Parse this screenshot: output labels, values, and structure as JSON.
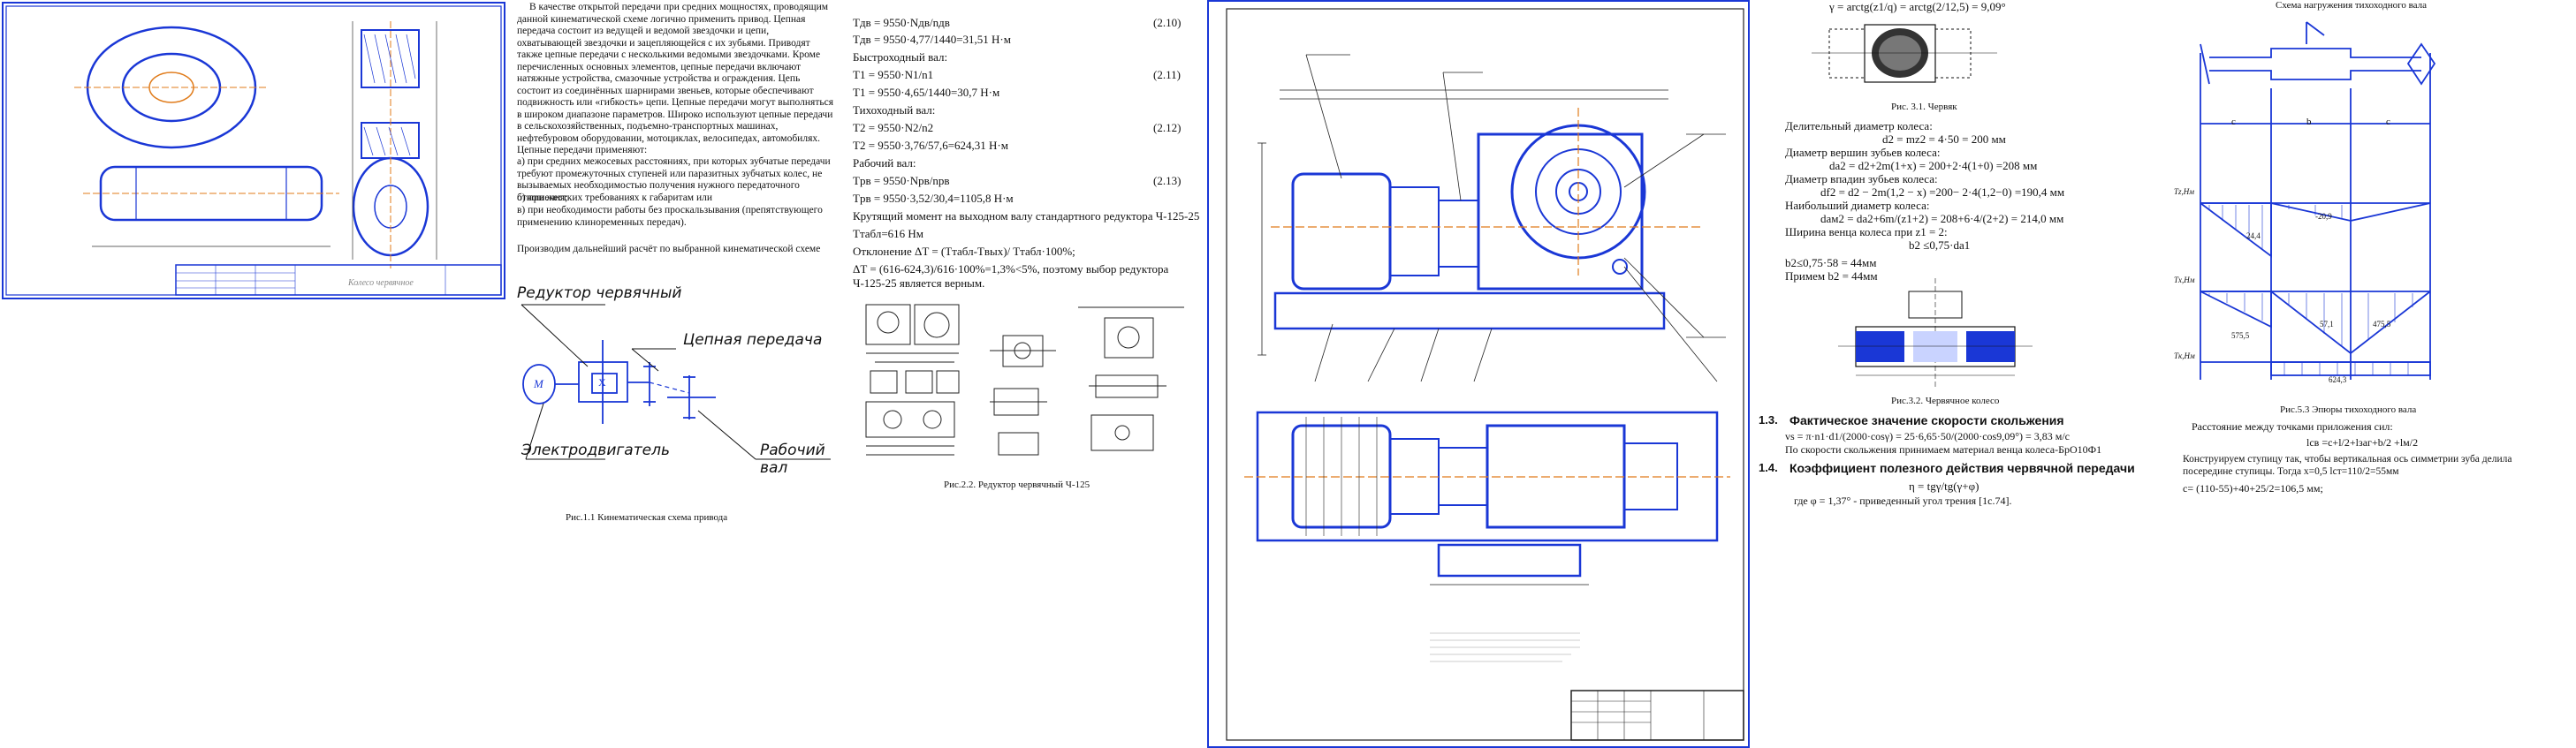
{
  "panel1": {
    "stamp": "Колесо червячное"
  },
  "panel2": {
    "paragraphs": [
      "В качестве открытой передачи при средних мощностях, проводящим данной кинематической схеме логично применить привод. Цепная передача состоит из ведущей и ведомой звездочки и цепи, охватывающей звездочки и зацепляющейся с их зубьями. Приводят также цепные передачи с несколькими ведомыми звездочками. Кроме перечисленных основных элементов, цепные передачи включают натяжные устройства, смазочные устройства и ограждения. Цепь состоит из соединённых шарнирами звеньев, которые обеспечивают подвижность или «гибкость» цепи. Цепные передачи могут выполняться в широком диапазоне параметров. Широко используют цепные передачи в сельскохозяйственных, подъемно-транспортных машинах, нефтебуровом оборудовании, мотоциклах, велосипедах, автомобилях. Цепные передачи применяют:",
      "а) при средних межосевых расстояниях, при которых зубчатые передачи требуют промежуточных ступеней или паразитных зубчатых колес, не вызываемых необходимостью получения нужного передаточного отношения;",
      "б) при жестких требованиях к габаритам или",
      "в) при необходимости работы без проскальзывания (препятствующего применению клиноременных передач).",
      "Производим дальнейший расчёт по выбранной кинематической схеме"
    ],
    "labels": {
      "reducer": "Редуктор червячный",
      "chain": "Цепная передача",
      "motor": "Электродвигатель",
      "shaft": "Рабочий вал",
      "m": "М",
      "x": "X"
    },
    "caption": "Рис.1.1 Кинематическая схема привода"
  },
  "panel3": {
    "lines": [
      {
        "text": "Tдв = 9550·Nдв/nдв",
        "num": "(2.10)"
      },
      {
        "text": "Tдв = 9550·4,77/1440=31,51 Н·м",
        "num": ""
      },
      {
        "text": "Быстроходный вал:",
        "num": ""
      },
      {
        "text": "T1 = 9550·N1/n1",
        "num": "(2.11)"
      },
      {
        "text": "T1 = 9550·4,65/1440=30,7 Н·м",
        "num": ""
      },
      {
        "text": "Тихоходный вал:",
        "num": ""
      },
      {
        "text": "T2 = 9550·N2/n2",
        "num": "(2.12)"
      },
      {
        "text": "T2 = 9550·3,76/57,6=624,31 Н·м",
        "num": ""
      },
      {
        "text": "Рабочий вал:",
        "num": ""
      },
      {
        "text": "Tрв = 9550·Nрв/nрв",
        "num": "(2.13)"
      },
      {
        "text": "Tрв = 9550·3,52/30,4=1105,8 Н·м",
        "num": ""
      },
      {
        "text": "Крутящий момент на выходном валу стандартного редуктора Ч-125-25",
        "num": ""
      },
      {
        "text": "Tтабл=616 Нм",
        "num": ""
      },
      {
        "text": "Отклонение ΔT = (Tтабл-Tвых)/ Tтабл·100%;",
        "num": ""
      },
      {
        "text": "ΔT = (616-624,3)/616·100%=1,3%<5%, поэтому выбор редуктора Ч-125-25 является верным.",
        "num": ""
      }
    ],
    "caption": "Рис.2.2. Редуктор червячный Ч-125"
  },
  "panel5": {
    "top_formula": "γ = arctg(z1/q) = arctg(2/12,5) = 9,09°",
    "fig_caption1": "Рис. 3.1. Червяк",
    "lines": [
      "Делительный диаметр колеса:",
      "d2 = mz2 = 4·50 = 200 мм",
      "Диаметр вершин зубьев колеса:",
      "da2 = d2+2m(1+x) = 200+2·4(1+0) =208 мм",
      "Диаметр впадин зубьев колеса:",
      "df2 = d2 − 2m(1,2 − x) =200− 2·4(1,2−0) =190,4 мм",
      "Наибольший диаметр колеса:",
      "daм2 = da2+6m/(z1+2) = 208+6·4/(2+2) = 214,0 мм",
      "Ширина венца колеса при z1 = 2:",
      "b2 ≤0,75·da1",
      "b2≤0,75·58 = 44мм",
      "Примем b2 = 44мм"
    ],
    "fig_caption2": "Рис.3.2. Червячное колесо",
    "h13": "1.3.",
    "h13_text": "Фактическое значение скорости скольжения",
    "vs": "vs = π·n1·d1/(2000·cosγ) = 25·6,65·50/(2000·cos9,09°) = 3,83 м/с",
    "vs_note": "По скорости скольжения принимаем материал венца колеса-БрО10Ф1",
    "h14": "1.4.",
    "h14_text": "Коэффициент полезного действия червячной передачи",
    "eta": "η = tgγ/tg(γ+φ)",
    "phi": "где φ = 1,37° - приведенный угол трения [1с.74]."
  },
  "panel6": {
    "title": "Схема нагружения тихоходного вала",
    "letters": [
      "c",
      "b",
      "c"
    ],
    "labels": [
      "Tz,Нм",
      "Tx,Нм",
      "Tк,Нм"
    ],
    "values": [
      "24,4",
      "57,1",
      "624,3",
      "575,5",
      "475,5",
      "-20,9"
    ],
    "caption": "Рис.5.3 Эпюры тихоходного вала",
    "text1": "Расстояние между точками приложения сил:",
    "formula1": "lсв =c+l/2+lзаг+b/2 +lм/2",
    "text2": "Конструируем ступицу так, чтобы вертикальная ось симметрии зуба делила посередине ступицы. Тогда x=0,5 lст=110/2=55мм",
    "text3": "c= (110-55)+40+25/2=106,5 мм;"
  }
}
